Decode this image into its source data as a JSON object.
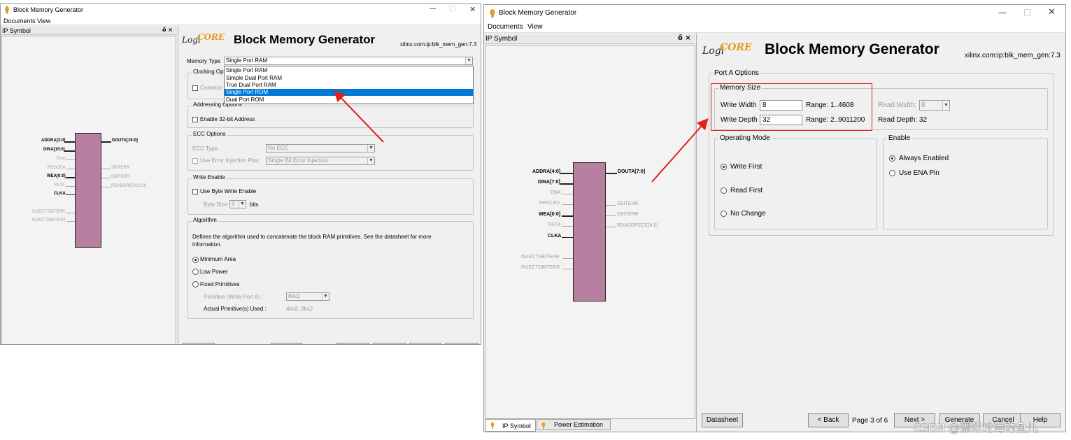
{
  "left_window": {
    "title": "Block Memory Generator",
    "menu": [
      "Documents",
      "View"
    ],
    "symbol_pane_title": "IP Symbol",
    "pane_buttons": "ő ×",
    "header": {
      "logo_logi": "Logi",
      "logo_core": "CORE",
      "title": "Block Memory Generator",
      "vlnv": "xilinx.com:ip:blk_mem_gen:7.3"
    },
    "memory_type": {
      "label": "Memory Type",
      "value": "Single Port RAM",
      "options": [
        "Single Port RAM",
        "Simple Dual Port RAM",
        "True Dual Port RAM",
        "Single Port ROM",
        "Dual Port ROM"
      ],
      "highlighted": "Single Port ROM"
    },
    "clocking": {
      "legend": "Clocking Opti",
      "common_label": "Common"
    },
    "addressing": {
      "legend": "Addressing Options",
      "enable32": "Enable 32-bit Address"
    },
    "ecc": {
      "legend": "ECC Options",
      "type_label": "ECC Type",
      "type_value": "No ECC",
      "inject_label": "Use Error Injection Pins",
      "inject_value": "Single Bit Error Injection"
    },
    "write_enable": {
      "legend": "Write Enable",
      "byte_write": "Use Byte Write Enable",
      "byte_size_label": "Byte Size",
      "byte_size_value": "9",
      "bits": "bits"
    },
    "algorithm": {
      "legend": "Algorithm",
      "desc1": "Defines the algorithm used to concatenate the block RAM primitives.  See the datasheet for more",
      "desc2": "information.",
      "min_area": "Minimum Area",
      "low_power": "Low Power",
      "fixed": "Fixed Primitives",
      "primitive_label": "Primitive (Write Port A) :",
      "primitive_value": "8kx2",
      "actual_label": "Actual Primitive(s) Used :",
      "actual_value": "4kx2, 8kx2"
    },
    "symbol": {
      "left_pins": [
        "ADDRA[3:0]",
        "DINA[15:0]",
        "ENA",
        "REGCEA",
        "WEA[0:0]",
        "RSTA",
        "CLKA",
        "INJECTSBITERR",
        "INJECTDBITERR"
      ],
      "right_pins": [
        "DOUTA[15:0]",
        "SBITERR",
        "DBITERR",
        "RDADDRECC[3:0]"
      ]
    }
  },
  "right_window": {
    "title": "Block Memory Generator",
    "menu": [
      "Documents",
      "View"
    ],
    "symbol_pane_title": "IP Symbol",
    "pane_buttons": "ő ×",
    "header": {
      "logo_logi": "Logi",
      "logo_core": "CORE",
      "title": "Block Memory Generator",
      "vlnv": "xilinx.com:ip:blk_mem_gen:7.3"
    },
    "port_a": {
      "legend": "Port A Options",
      "memory_size": {
        "legend": "Memory Size",
        "write_width_label": "Write Width",
        "write_width_value": "8",
        "write_width_range": "Range: 1..4608",
        "write_depth_label": "Write Depth",
        "write_depth_value": "32",
        "write_depth_range": "Range: 2..9011200",
        "read_width_label": "Read Width:",
        "read_width_value": "8",
        "read_depth": "Read Depth: 32"
      },
      "operating_mode": {
        "legend": "Operating Mode",
        "options": [
          "Write First",
          "Read First",
          "No Change"
        ]
      },
      "enable": {
        "legend": "Enable",
        "options": [
          "Always Enabled",
          "Use ENA Pin"
        ]
      }
    },
    "symbol": {
      "left_pins": [
        "ADDRA[4:0]",
        "DINA[7:0]",
        "ENA",
        "REGCEA",
        "WEA[0:0]",
        "RSTA",
        "CLKA",
        "INJECTSBITERR",
        "INJECTDBITERR"
      ],
      "right_pins": [
        "DOUTA[7:0]",
        "SBITERR",
        "DBITERR",
        "RDADDRECC[4:0]"
      ]
    },
    "tabs": [
      "IP Symbol",
      "Power Estimation"
    ],
    "buttons": {
      "datasheet": "Datasheet",
      "back": "< Back",
      "page": "Page 3 of 6",
      "next": "Next >",
      "generate": "Generate",
      "cancel": "Cancel",
      "help": "Help"
    }
  },
  "watermark": "CSDN @漂洋过海的鱼儿",
  "colors": {
    "block_fill": "#b87fa0",
    "selection": "#0078d7",
    "annotation": "#e0201b",
    "logo_core": "#e49b19"
  }
}
